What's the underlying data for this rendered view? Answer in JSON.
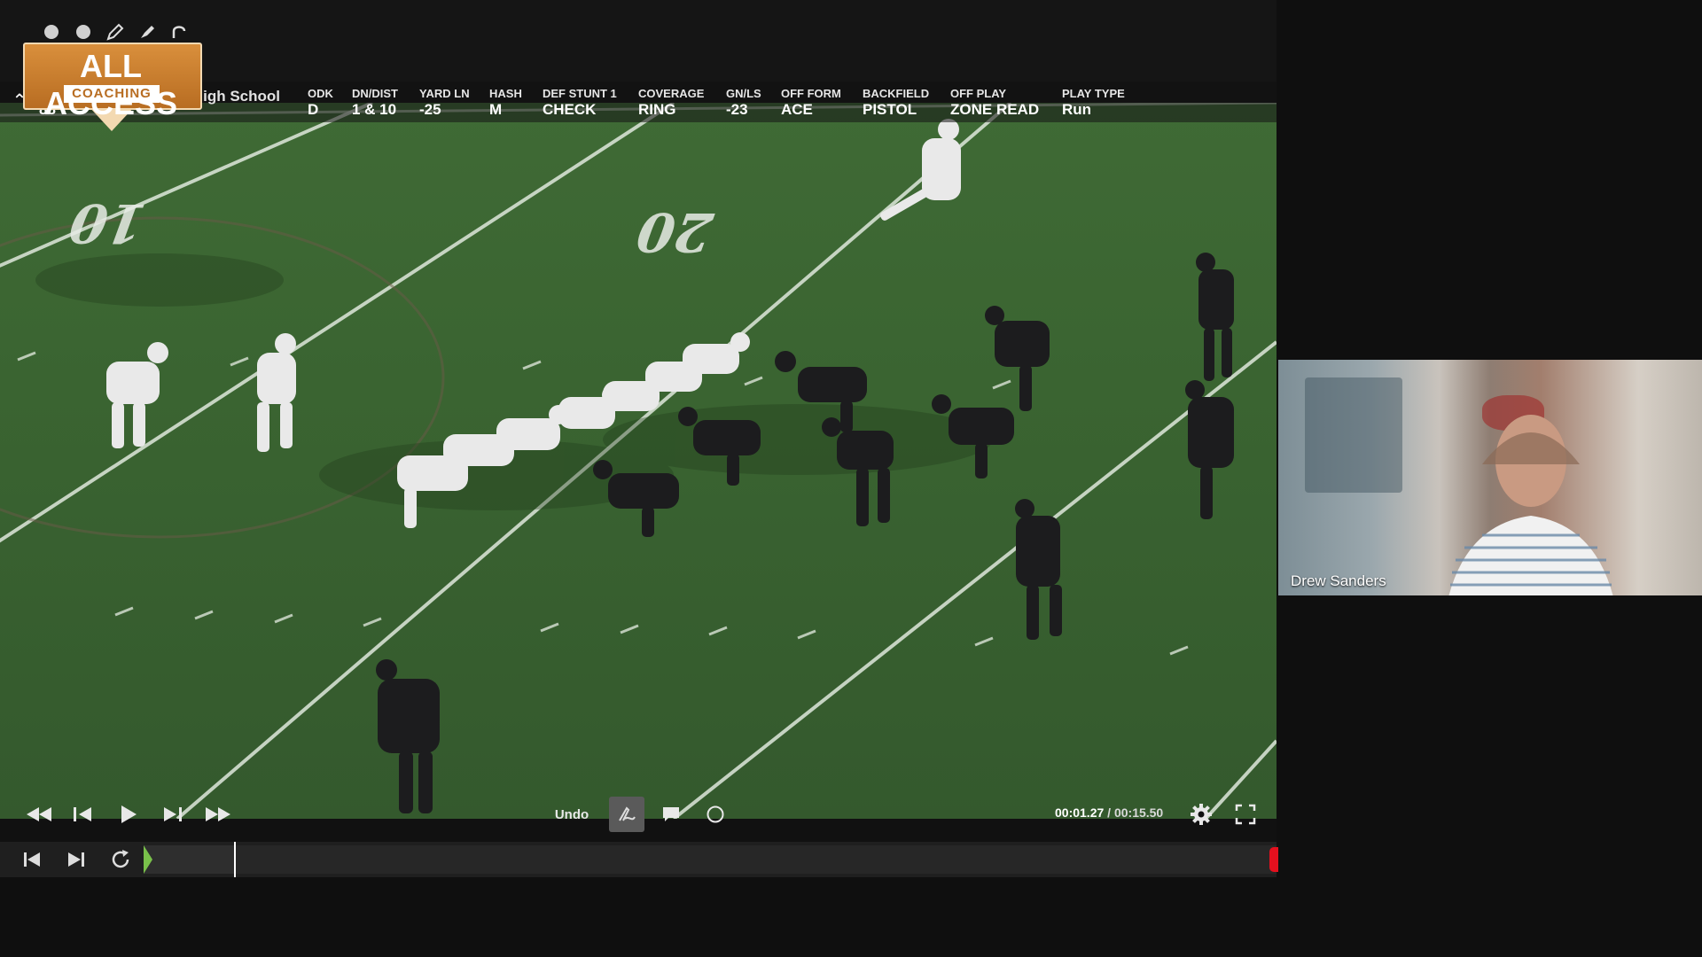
{
  "app": {
    "logo_title": "ALL ACCESS",
    "logo_subtitle": "COACHING"
  },
  "annotation_tools": {
    "icons": [
      "circle-dot-icon",
      "circle-dot-icon",
      "pencil-icon",
      "highlighter-icon",
      "lasso-icon"
    ]
  },
  "play_info": {
    "columns": [
      {
        "header": "PL",
        "value": "88"
      },
      {
        "header": "",
        "value": "Round Rock High School"
      },
      {
        "header": "ODK",
        "value": "D"
      },
      {
        "header": "DN/DIST",
        "value": "1 & 10"
      },
      {
        "header": "YARD LN",
        "value": "-25"
      },
      {
        "header": "HASH",
        "value": "M"
      },
      {
        "header": "DEF STUNT 1",
        "value": "CHECK"
      },
      {
        "header": "COVERAGE",
        "value": "RING"
      },
      {
        "header": "GN/LS",
        "value": "-23"
      },
      {
        "header": "OFF FORM",
        "value": "ACE"
      },
      {
        "header": "BACKFIELD",
        "value": "PISTOL"
      },
      {
        "header": "OFF PLAY",
        "value": "ZONE READ"
      },
      {
        "header": "PLAY TYPE",
        "value": "Run"
      }
    ]
  },
  "field": {
    "yard_markers": [
      "10",
      "20"
    ]
  },
  "controls": {
    "undo_label": "Undo",
    "current_time": "00:01.27",
    "separator": " / ",
    "duration": "00:15.50"
  },
  "webcam": {
    "participant_name": "Drew Sanders"
  },
  "colors": {
    "brand_orange": "#c97b2c",
    "timeline_green": "#79c04a",
    "timeline_end_red": "#e5101e",
    "field_green": "#3a6431"
  }
}
